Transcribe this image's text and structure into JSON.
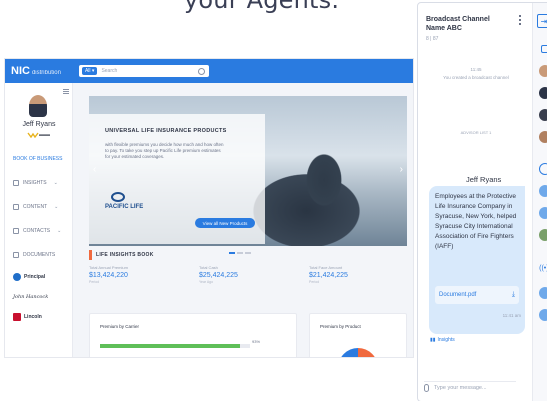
{
  "headline": "your Agents.",
  "app": {
    "logo": "NIC",
    "logo_sub": "distribution",
    "search_scope": "All ▾",
    "search_placeholder": "Search",
    "user": {
      "name": "Jeff Ryans"
    },
    "nav": [
      {
        "label": "BOOK OF BUSINESS",
        "active": true,
        "icon": "book-icon"
      },
      {
        "label": "INSIGHTS",
        "active": false,
        "icon": "chart-icon"
      },
      {
        "label": "CONTENT",
        "active": false,
        "icon": "content-icon"
      },
      {
        "label": "CONTACTS",
        "active": false,
        "icon": "contacts-icon"
      },
      {
        "label": "DOCUMENTS",
        "active": false,
        "icon": "document-icon"
      }
    ],
    "partners": [
      "Principal",
      "John Hancock",
      "Lincoln"
    ],
    "hero": {
      "title": "UNIVERSAL LIFE INSURANCE PRODUCTS",
      "desc": "with flexible premiums you decide how much and how often to pay. To take you step up Pacific Life premium estimates for your estimated coverages.",
      "brand": "PACIFIC LIFE",
      "button": "View all New Products"
    },
    "section_title": "LIFE INSIGHTS BOOK",
    "stats": [
      {
        "label": "Total Annual Premium",
        "value": "$13,424,220",
        "sub": "Period"
      },
      {
        "label": "Total Cash",
        "value": "$25,424,225",
        "sub": "Year Ago"
      },
      {
        "label": "Total Face Amount",
        "value": "$21,424,225",
        "sub": "Period"
      }
    ],
    "cards": [
      {
        "title": "Premium by Carrier",
        "progress": 0.93,
        "progress_label": "93%"
      },
      {
        "title": "Premium by Product"
      }
    ]
  },
  "phone": {
    "title_line1": "Broadcast Channel",
    "title_line2": "Name ABC",
    "subtitle": "8 | 87",
    "time1": "11:45",
    "system_msg": "You created a broadcast channel",
    "advisor_label": "ADVISOR LIST 1",
    "sender": "Jeff Ryans",
    "message": "Employees at the Protective Life Insurance Company in Syracuse, New York, helped Syracuse City International Association of Fire Fighters (IAFF)",
    "attachment": "Document.pdf",
    "time2": "11:41 am",
    "insights_label": "Insights",
    "input_placeholder": "Type your message...",
    "colors": {
      "accent": "#2a7be0",
      "bubble": "#d8e9fb"
    }
  }
}
